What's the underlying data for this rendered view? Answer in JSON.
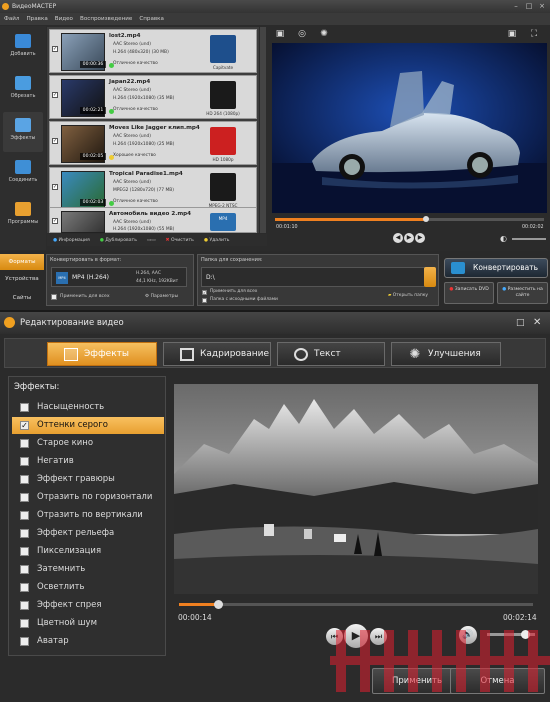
{
  "app_title": "ВидеоМАСТЕР",
  "menu": [
    "Файл",
    "Правка",
    "Видео",
    "Воспроизведение",
    "Справка"
  ],
  "sidebar": [
    "Добавить",
    "Обрезать",
    "Эффекты",
    "Соединить",
    "Программы"
  ],
  "files": [
    {
      "name": "lost2.mp4",
      "audio": "AAC Stereo (und)",
      "video": "H.264 (480x320) (30 MB)",
      "quality": "Отличное качество",
      "duration": "00:00:36",
      "format": "Capitvate",
      "badge_color": "#1e4f8c"
    },
    {
      "name": "Japan22.mp4",
      "audio": "AAC Stereo (und)",
      "video": "H.264 (1920x1080) (35 MB)",
      "quality": "Отличное качество",
      "duration": "00:02:21",
      "format": "HD 264 (1080p)",
      "badge_color": "#1a1a1a"
    },
    {
      "name": "Moves Like Jagger клип.mp4",
      "audio": "AAC Stereo (und)",
      "video": "H.264 (1920x1080) (25 MB)",
      "quality": "Хорошее качество",
      "duration": "00:02:05",
      "format": "HD 1080p",
      "badge_color": "#cc2020"
    },
    {
      "name": "Tropical Paradise1.mp4",
      "audio": "AAC Stereo (und)",
      "video": "MPEG2 (1280x720) (77 MB)",
      "quality": "Отличное качество",
      "duration": "00:02:03",
      "format": "MPEG-2 NTSC",
      "badge_color": "#1a1a1a"
    },
    {
      "name": "Автомобиль видео 2.mp4",
      "audio": "AAC Stereo (und)",
      "video": "H.264 (1920x1080) (55 MB)",
      "quality": "",
      "duration": "",
      "format": "MP4",
      "badge_color": "#2a6fb0"
    }
  ],
  "list_actions": [
    "Информация",
    "Дублировать",
    "Очистить",
    "Удалить"
  ],
  "player1": {
    "current": "00:01:10",
    "total": "00:02:02",
    "progress": 0.56
  },
  "bottom_tabs": [
    "Форматы",
    "Устройства",
    "Сайты"
  ],
  "convert_format": {
    "label": "Конвертировать в формат:",
    "format": "MP4 (H.264)",
    "badge": "MP4",
    "spec1": "H.264, AAC",
    "spec2": "44,1 KHz, 192KBит",
    "apply_all": "Применить для всех",
    "params": "Параметры"
  },
  "save_folder": {
    "label": "Папка для сохранения:",
    "path": "D:\\",
    "apply_all": "Применить для всех",
    "source_folder": "Папка с исходными файлами",
    "open_folder": "Открыть папку"
  },
  "actions": {
    "convert": "Конвертировать",
    "dvd": "Записать DVD",
    "web": "Разместить на сайте"
  },
  "dialog": {
    "title": "Редактирование видео",
    "tabs": [
      "Эффекты",
      "Кадрирование",
      "Текст",
      "Улучшения"
    ],
    "effects_header": "Эффекты:",
    "effects": [
      "Насыщенность",
      "Оттенки серого",
      "Старое кино",
      "Негатив",
      "Эффект гравюры",
      "Отразить по горизонтали",
      "Отразить по вертикали",
      "Эффект рельефа",
      "Пикселизация",
      "Затемнить",
      "Осветлить",
      "Эффект спрея",
      "Цветной шум",
      "Аватар"
    ],
    "selected_index": 1,
    "player": {
      "current": "00:00:14",
      "total": "00:02:14",
      "progress": 0.11,
      "volume": 0.8
    },
    "apply": "Применить",
    "cancel": "Отмена"
  },
  "colors": {
    "accent": "#f0a020",
    "panel": "#2b2b2b"
  }
}
